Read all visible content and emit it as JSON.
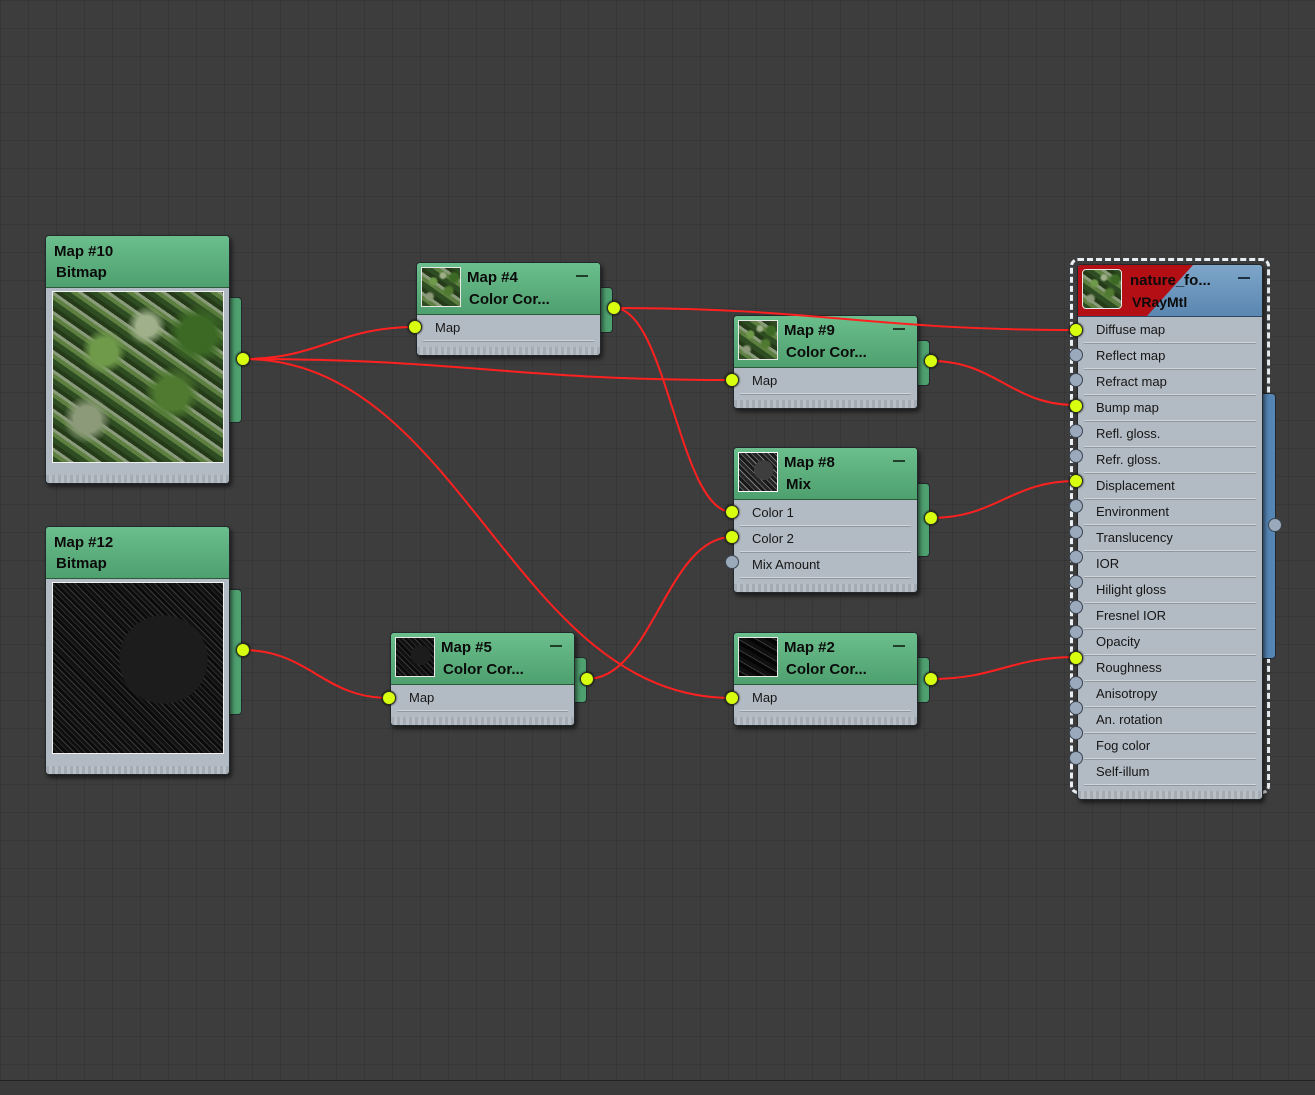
{
  "nodes": {
    "map10": {
      "title": "Map #10",
      "subtitle": "Bitmap"
    },
    "map12": {
      "title": "Map #12",
      "subtitle": "Bitmap"
    },
    "map4": {
      "title": "Map #4",
      "subtitle": "Color  Cor...",
      "slots": [
        "Map"
      ]
    },
    "map5": {
      "title": "Map #5",
      "subtitle": "Color  Cor...",
      "slots": [
        "Map"
      ]
    },
    "map9": {
      "title": "Map #9",
      "subtitle": "Color  Cor...",
      "slots": [
        "Map"
      ]
    },
    "map8": {
      "title": "Map #8",
      "subtitle": "Mix",
      "slots": [
        "Color 1",
        "Color 2",
        "Mix Amount"
      ]
    },
    "map2": {
      "title": "Map #2",
      "subtitle": "Color  Cor...",
      "slots": [
        "Map"
      ]
    },
    "material": {
      "title": "nature_fo...",
      "subtitle": "VRayMtl",
      "slots": [
        "Diffuse map",
        "Reflect map",
        "Refract map",
        "Bump map",
        "Refl. gloss.",
        "Refr. gloss.",
        "Displacement",
        "Environment",
        "Translucency",
        "IOR",
        "Hilight gloss",
        "Fresnel IOR",
        "Opacity",
        "Roughness",
        "Anisotropy",
        "An. rotation",
        "Fog color",
        "Self-illum"
      ],
      "connected_slots": [
        "Diffuse map",
        "Bump map",
        "Displacement",
        "Roughness"
      ]
    }
  },
  "colors": {
    "canvas": "#3d3d3d",
    "map_header": "#5aae7c",
    "material_header": "#6a96be",
    "node_body": "#b2bac3",
    "wire": "#ff2020",
    "socket_connected": "#d8ff10",
    "socket_empty": "#9aa9bb"
  },
  "icons": {
    "collapse": "minus-icon",
    "socket_connected": "socket-dot-connected-icon",
    "socket_empty": "socket-dot-empty-icon"
  }
}
